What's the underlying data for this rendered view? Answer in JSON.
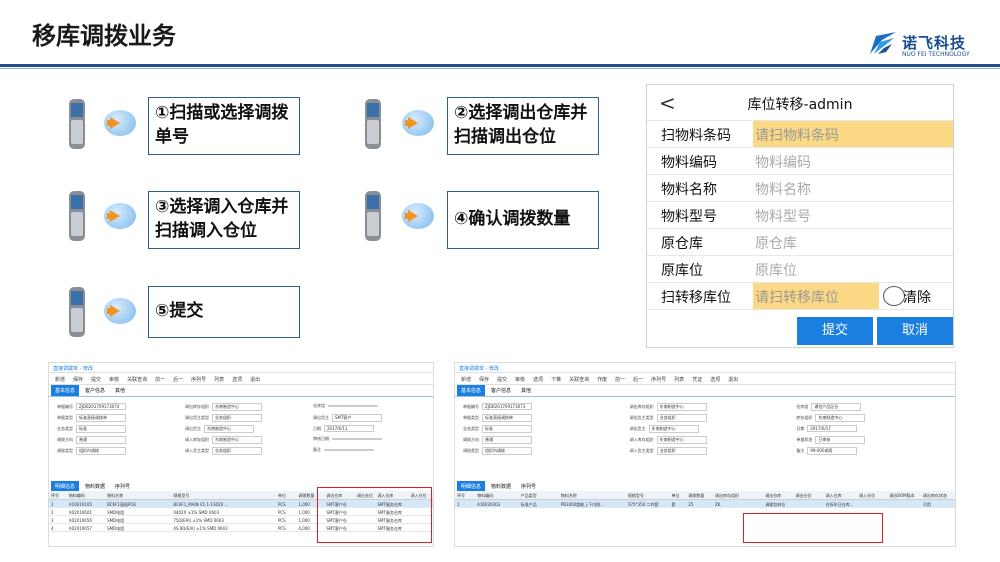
{
  "title": "移库调拨业务",
  "logo": {
    "cn": "诺飞科技",
    "en": "NUO FEI TECHNOLOGY"
  },
  "steps": [
    {
      "label": "①扫描或选择调拨单号"
    },
    {
      "label": "②选择调出仓库并扫描调出仓位"
    },
    {
      "label": "③选择调入仓库并扫描调入仓位"
    },
    {
      "label": "④确认调拨数量"
    },
    {
      "label": "⑤提交"
    }
  ],
  "mobile": {
    "back": "<",
    "title": "库位转移-admin",
    "fields": [
      {
        "label": "扫物料条码",
        "value": "请扫物料条码",
        "highlight": true
      },
      {
        "label": "物料编码",
        "value": "物料编码",
        "highlight": false
      },
      {
        "label": "物料名称",
        "value": "物料名称",
        "highlight": false
      },
      {
        "label": "物料型号",
        "value": "物料型号",
        "highlight": false
      },
      {
        "label": "原仓库",
        "value": "原仓库",
        "highlight": false
      },
      {
        "label": "原库位",
        "value": "原库位",
        "highlight": false
      },
      {
        "label": "扫转移库位",
        "value": "请扫转移库位",
        "highlight": true
      }
    ],
    "clear_label": "清除",
    "submit": "提交",
    "cancel": "取消"
  },
  "erp_left": {
    "title": "直接调拨单 - 修改",
    "toolbar": [
      "新增",
      "保存",
      "提交",
      "审核",
      "关联查询",
      "前一",
      "后一",
      "序列号",
      "列表",
      "选项",
      "退出"
    ],
    "tabs": [
      "基本信息",
      "客户信息",
      "其他"
    ],
    "form": [
      [
        "单据编号",
        "ZJDB201709173074"
      ],
      [
        "调出库存组织",
        "东南制造中心"
      ],
      [
        "仓库组",
        ""
      ],
      [
        "单据类型",
        "标准直接调拨单"
      ],
      [
        "调出货主类型",
        "业务组织"
      ],
      [
        "调出货主",
        "SMT客户"
      ],
      [
        "业务类型",
        "标准"
      ],
      [
        "调出货主",
        "东南制造中心"
      ],
      [
        "日期",
        "2017/6/11"
      ],
      [
        "调拨方向",
        "普通"
      ],
      [
        "调入库存组织",
        "东南制造中心"
      ],
      [
        "审核日期",
        ""
      ],
      [
        "调拨类型",
        "组织内调拨"
      ],
      [
        "调入货主类型",
        "业务组织"
      ],
      [
        "备注",
        ""
      ]
    ],
    "sub_tabs": [
      "明细信息",
      "物料数据",
      "序列号"
    ],
    "columns": [
      "序号",
      "物料编码",
      "物料名称",
      "规格型号",
      "单位",
      "调拨数量",
      "调出仓库",
      "调出仓位",
      "调入仓库",
      "调入仓位"
    ],
    "rows": [
      [
        "1",
        "A10010105",
        "BC6F1直插PCB",
        "BC6F1_MAIN V1.1-13020 ...",
        "PCS",
        "1,000",
        "SMT客户仓",
        "",
        "SMT服务仓库",
        ""
      ],
      [
        "2",
        "A02010601",
        "SMD电阻",
        "0402X ±1% SMD 0603",
        "PCS",
        "1,000",
        "SMT客户仓",
        "",
        "SMT服务仓库",
        ""
      ],
      [
        "3",
        "A02010656",
        "SMD电阻",
        "75Ω(EIA) ±1% SMD 0603",
        "PCS",
        "1,000",
        "SMT客户仓",
        "",
        "SMT服务仓库",
        ""
      ],
      [
        "4",
        "A02010657",
        "SMD电阻",
        "4S.9Ω(EIA) ±1% SMD 0603",
        "PCS",
        "4,000",
        "SMT客户仓",
        "",
        "SMT服务仓库",
        ""
      ]
    ]
  },
  "erp_right": {
    "title": "直接调拨单 - 修改",
    "toolbar": [
      "新增",
      "保存",
      "提交",
      "审核",
      "选项",
      "下推",
      "关联查询",
      "作废",
      "前一",
      "后一",
      "序列号",
      "列表",
      "凭证",
      "选项",
      "退出"
    ],
    "tabs": [
      "基本信息",
      "客户信息",
      "其他"
    ],
    "form": [
      [
        "单据编号",
        "ZJDB201709173073"
      ],
      [
        "调出库存组织",
        "东南制造中心"
      ],
      [
        "仓库组",
        "通信产品区仓"
      ],
      [
        "单据类型",
        "标准直接调拨单"
      ],
      [
        "调出货主类型",
        "业务组织"
      ],
      [
        "库存组织",
        "东南制造中心"
      ],
      [
        "业务类型",
        "标准"
      ],
      [
        "调出货主",
        "东南制造中心"
      ],
      [
        "日期",
        "2017/6/17"
      ],
      [
        "调拨方向",
        "普通"
      ],
      [
        "调入库存组织",
        "东南制造中心"
      ],
      [
        "单据状态",
        "已审核"
      ],
      [
        "调拨类型",
        "组织内调拨"
      ],
      [
        "调入货主类型",
        "业务组织"
      ],
      [
        "备注",
        "99-000调用"
      ]
    ],
    "sub_tabs": [
      "明细信息",
      "物料数据",
      "序列号"
    ],
    "columns": [
      "序号",
      "物料编码",
      "产品类型",
      "物料名称",
      "规格型号",
      "单位",
      "调拨数量",
      "调出库存组织",
      "调出仓库",
      "调出仓位",
      "调入仓库",
      "调入仓位",
      "调出BOM版本",
      "调出库存状态"
    ],
    "rows": [
      [
        "1",
        "A16020303",
        "标准产品",
        "PB3000超能上下内胆...",
        "375*350 二件套",
        "套",
        "25",
        "ZK",
        "调拨包材仓",
        "",
        "仓拆车日仓库...",
        "",
        "",
        "可用"
      ]
    ]
  }
}
